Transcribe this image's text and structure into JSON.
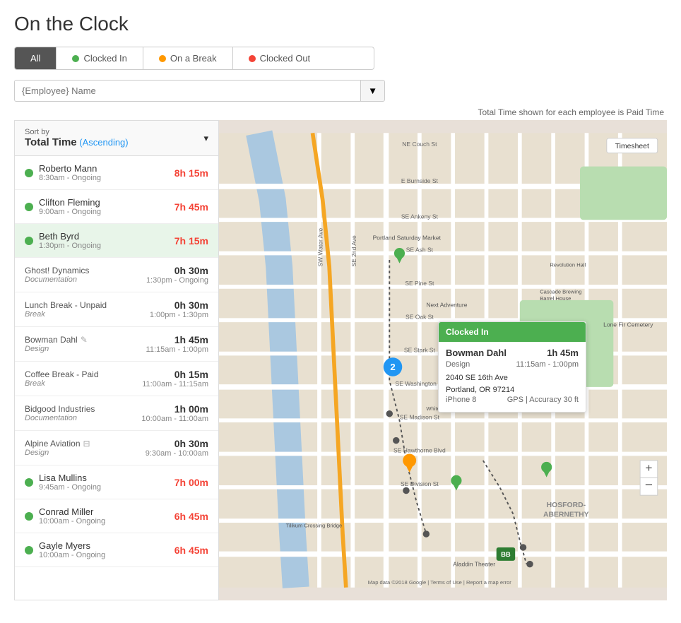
{
  "page": {
    "title": "On the Clock"
  },
  "filter": {
    "buttons": [
      {
        "label": "All",
        "active": true,
        "dot": null
      },
      {
        "label": "Clocked In",
        "active": false,
        "dot": "green"
      },
      {
        "label": "On a Break",
        "active": false,
        "dot": "orange"
      },
      {
        "label": "Clocked Out",
        "active": false,
        "dot": "red"
      }
    ]
  },
  "search": {
    "placeholder": "{Employee} Name"
  },
  "paid_time_note": "Total Time shown for each employee is Paid Time",
  "sort": {
    "label": "Sort by",
    "value": "Total Time",
    "ascending": "(Ascending)"
  },
  "employees": [
    {
      "id": "roberto-mann",
      "name": "Roberto Mann",
      "dot": "green",
      "time": "8h 15m",
      "schedule": "8:30am - Ongoing",
      "entries": []
    },
    {
      "id": "clifton-fleming",
      "name": "Clifton Fleming",
      "dot": "green",
      "time": "7h 45m",
      "schedule": "9:00am - Ongoing",
      "entries": []
    },
    {
      "id": "beth-byrd",
      "name": "Beth Byrd",
      "dot": "green",
      "time": "7h 15m",
      "schedule": "1:30pm - Ongoing",
      "selected": true,
      "entries": [
        {
          "sub_name": "Ghost! Dynamics",
          "category": "Documentation",
          "time": "0h 30m",
          "schedule": "1:30pm - Ongoing"
        },
        {
          "sub_name": "Lunch Break - Unpaid",
          "category": "Break",
          "time": "0h 30m",
          "schedule": "1:00pm - 1:30pm"
        },
        {
          "sub_name": "Bowman Dahl",
          "category": "Design",
          "time": "1h 45m",
          "schedule": "11:15am - 1:00pm",
          "edit": true
        },
        {
          "sub_name": "Coffee Break - Paid",
          "category": "Break",
          "time": "0h 15m",
          "schedule": "11:00am - 11:15am"
        },
        {
          "sub_name": "Bidgood Industries",
          "category": "Documentation",
          "time": "1h 00m",
          "schedule": "10:00am - 11:00am"
        },
        {
          "sub_name": "Alpine Aviation",
          "category": "Design",
          "time": "0h 30m",
          "schedule": "9:30am - 10:00am",
          "edit_icon": true
        }
      ]
    },
    {
      "id": "lisa-mullins",
      "name": "Lisa Mullins",
      "dot": "green",
      "time": "7h 00m",
      "schedule": "9:45am - Ongoing",
      "entries": []
    },
    {
      "id": "conrad-miller",
      "name": "Conrad Miller",
      "dot": "green",
      "time": "6h 45m",
      "schedule": "10:00am - Ongoing",
      "entries": []
    },
    {
      "id": "gayle-myers",
      "name": "Gayle Myers",
      "dot": "green",
      "time": "6h 45m",
      "schedule": "10:00am - Ongoing",
      "entries": []
    }
  ],
  "map_popup": {
    "header": "Clocked In",
    "name": "Bowman Dahl",
    "time": "1h 45m",
    "category": "Design",
    "schedule": "11:15am - 1:00pm",
    "address1": "2040 SE 16th Ave",
    "address2": "Portland, OR 97214",
    "device": "iPhone 8",
    "gps": "GPS | Accuracy 30 ft"
  },
  "map": {
    "timesheet_label": "Timesheet",
    "attribution": "Map data ©2018 Google | Terms of Use | Report a map error"
  },
  "zoom": {
    "plus": "+",
    "minus": "−"
  }
}
